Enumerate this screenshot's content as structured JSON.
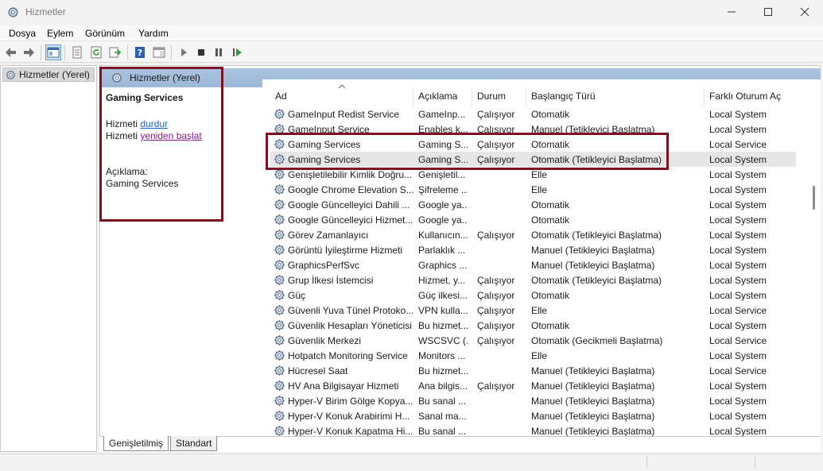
{
  "window": {
    "title": "Hizmetler",
    "controls": [
      "minimize",
      "maximize",
      "close"
    ]
  },
  "menu": {
    "items": [
      "Dosya",
      "Eylem",
      "Görünüm",
      "Yardım"
    ]
  },
  "toolbar": {
    "icons": [
      "back-arrow-icon",
      "forward-arrow-icon",
      "console-tree-icon",
      "properties-icon",
      "refresh-icon",
      "export-list-icon",
      "help-icon",
      "show-hide-icon",
      "start-service-icon",
      "stop-service-icon",
      "pause-service-icon",
      "resume-service-icon"
    ]
  },
  "tree": {
    "root_label": "Hizmetler (Yerel)"
  },
  "header": {
    "label": "Hizmetler (Yerel)"
  },
  "details": {
    "service_name": "Gaming Services",
    "stop_prefix": "Hizmeti ",
    "stop_link": "durdur",
    "restart_prefix": "Hizmeti ",
    "restart_link": "yeniden başlat",
    "description_label": "Açıklama:",
    "description_value": "Gaming Services"
  },
  "columns": {
    "name": "Ad",
    "description": "Açıklama",
    "status": "Durum",
    "startup": "Başlangıç Türü",
    "logon": "Farklı Oturum Aç"
  },
  "services": [
    {
      "name": "GameInput Redist Service",
      "description": "GameInp...",
      "status": "Çalışıyor",
      "startup": "Otomatik",
      "logon": "Local System"
    },
    {
      "name": "GameInput Service",
      "description": "Enables k...",
      "status": "Çalışıyor",
      "startup": "Manuel (Tetikleyici Başlatma)",
      "logon": "Local System"
    },
    {
      "name": "Gaming Services",
      "description": "Gaming S...",
      "status": "Çalışıyor",
      "startup": "Otomatik",
      "logon": "Local Service"
    },
    {
      "name": "Gaming Services",
      "description": "Gaming S...",
      "status": "Çalışıyor",
      "startup": "Otomatik (Tetikleyici Başlatma)",
      "logon": "Local System"
    },
    {
      "name": "Genişletilebilir Kimlik Doğru...",
      "description": "Genişletil...",
      "status": "",
      "startup": "Elle",
      "logon": "Local System"
    },
    {
      "name": "Google Chrome Elevation S...",
      "description": "Şifreleme ...",
      "status": "",
      "startup": "Elle",
      "logon": "Local System"
    },
    {
      "name": "Google Güncelleyici Dahili ...",
      "description": "Google ya...",
      "status": "",
      "startup": "Otomatik",
      "logon": "Local System"
    },
    {
      "name": "Google Güncelleyici Hizmet...",
      "description": "Google ya...",
      "status": "",
      "startup": "Otomatik",
      "logon": "Local System"
    },
    {
      "name": "Görev Zamanlayıcı",
      "description": "Kullanıcın...",
      "status": "Çalışıyor",
      "startup": "Otomatik (Tetikleyici Başlatma)",
      "logon": "Local System"
    },
    {
      "name": "Görüntü İyileştirme Hizmeti",
      "description": "Parlaklık ...",
      "status": "",
      "startup": "Manuel (Tetikleyici Başlatma)",
      "logon": "Local System"
    },
    {
      "name": "GraphicsPerfSvc",
      "description": "Graphics ...",
      "status": "",
      "startup": "Manuel (Tetikleyici Başlatma)",
      "logon": "Local System"
    },
    {
      "name": "Grup İlkesi İstemcisi",
      "description": "Hizmet, y...",
      "status": "Çalışıyor",
      "startup": "Otomatik (Tetikleyici Başlatma)",
      "logon": "Local System"
    },
    {
      "name": "Güç",
      "description": "Güç ilkesi...",
      "status": "Çalışıyor",
      "startup": "Otomatik",
      "logon": "Local System"
    },
    {
      "name": "Güvenli Yuva Tünel Protoko...",
      "description": "VPN kulla...",
      "status": "Çalışıyor",
      "startup": "Elle",
      "logon": "Local Service"
    },
    {
      "name": "Güvenlik Hesapları Yöneticisi",
      "description": "Bu hizmet...",
      "status": "Çalışıyor",
      "startup": "Otomatik",
      "logon": "Local System"
    },
    {
      "name": "Güvenlik Merkezi",
      "description": "WSCSVC (...",
      "status": "Çalışıyor",
      "startup": "Otomatik (Gecikmeli Başlatma)",
      "logon": "Local Service"
    },
    {
      "name": "Hotpatch Monitoring Service",
      "description": "Monitors ...",
      "status": "",
      "startup": "Elle",
      "logon": "Local System"
    },
    {
      "name": "Hücresel Saat",
      "description": "Bu hizmet...",
      "status": "",
      "startup": "Manuel (Tetikleyici Başlatma)",
      "logon": "Local Service"
    },
    {
      "name": "HV Ana Bilgisayar Hizmeti",
      "description": "Ana bilgis...",
      "status": "Çalışıyor",
      "startup": "Manuel (Tetikleyici Başlatma)",
      "logon": "Local System"
    },
    {
      "name": "Hyper-V Birim Gölge Kopya...",
      "description": "Bu sanal ...",
      "status": "",
      "startup": "Manuel (Tetikleyici Başlatma)",
      "logon": "Local System"
    },
    {
      "name": "Hyper-V Konuk Arabirimi H...",
      "description": "Sanal ma...",
      "status": "",
      "startup": "Manuel (Tetikleyici Başlatma)",
      "logon": "Local System"
    },
    {
      "name": "Hyper-V Konuk Kapatma Hi...",
      "description": "Bu sanal ...",
      "status": "",
      "startup": "Manuel (Tetikleyici Başlatma)",
      "logon": "Local System"
    }
  ],
  "selected_row": 3,
  "tabs": [
    "Genişletilmiş",
    "Standart"
  ],
  "colors": {
    "highlight_border": "#7b1020",
    "header_banner": "#a9c2df",
    "link": "#1665c1",
    "visited_link": "#8a1a8a"
  }
}
